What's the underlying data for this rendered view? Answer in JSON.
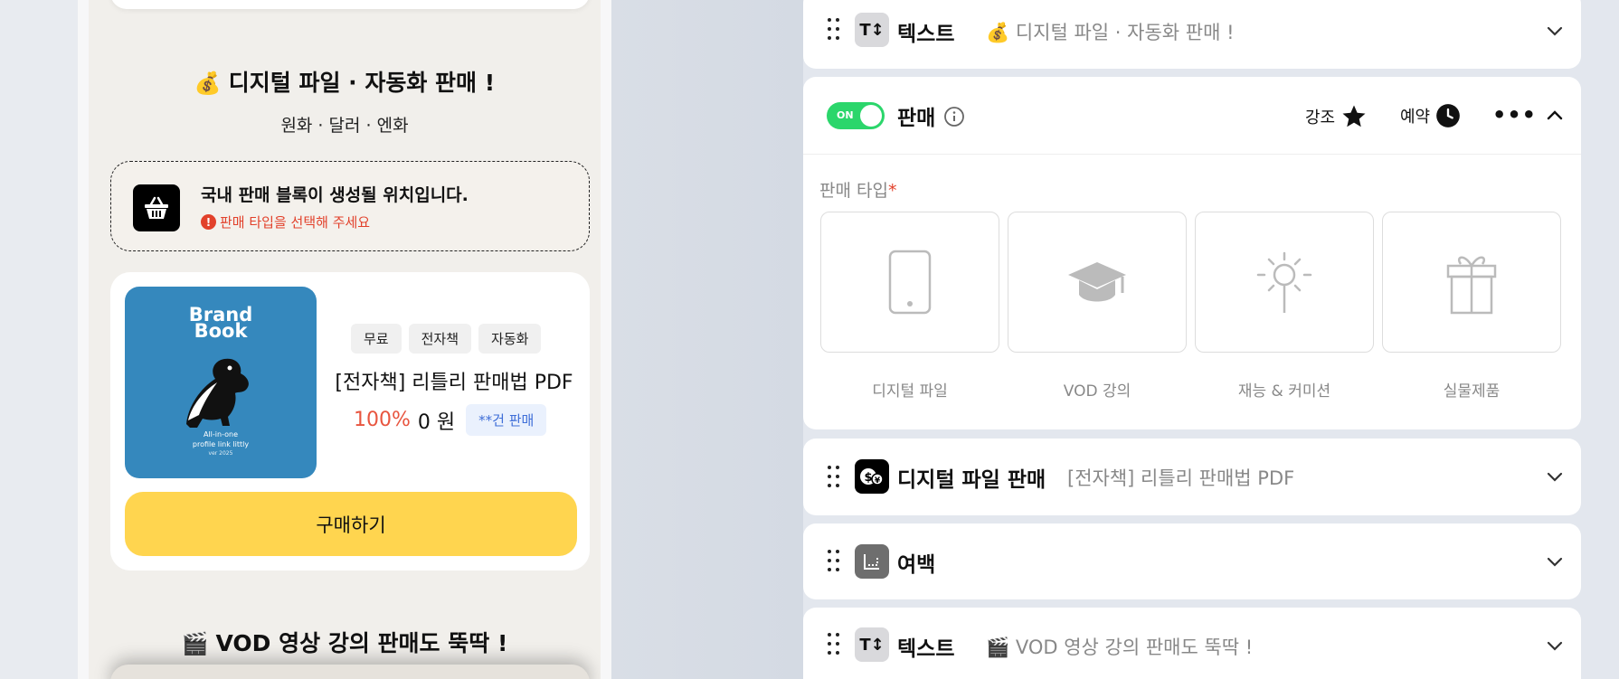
{
  "preview": {
    "heading1_emoji": "💰",
    "heading1": "디지털 파일 · 자동화 판매 !",
    "sub1": "원화 · 달러 · 엔화",
    "notice_title": "국내 판매 블록이 생성될 위치입니다.",
    "notice_warning": "판매 타입을 선택해 주세요",
    "cover_title_line1": "Brand",
    "cover_title_line2": "Book",
    "cover_small_line1": "All-in-one",
    "cover_small_line2": "profile link littly",
    "cover_version": "ver 2025",
    "tags": [
      "무료",
      "전자책",
      "자동화"
    ],
    "product_title": "[전자책] 리틀리 판매법 PDF",
    "discount": "100%",
    "price": "0 원",
    "sold_badge": "**건 판매",
    "buy_button": "구매하기",
    "heading2_emoji": "🎬",
    "heading2": "VOD 영상 강의 판매도 뚝딱 !"
  },
  "editor": {
    "text_block_1": {
      "title": "텍스트",
      "emoji": "💰",
      "summary": "디지털 파일 · 자동화 판매 !"
    },
    "sale_block": {
      "toggle_label": "ON",
      "title": "판매",
      "emphasis_label": "강조",
      "reserve_label": "예약",
      "more_label": "•••",
      "sale_type_label": "판매 타입",
      "required_mark": "*",
      "options": [
        {
          "label": "디지털 파일",
          "icon": "phone-icon"
        },
        {
          "label": "VOD 강의",
          "icon": "graduation-cap-icon"
        },
        {
          "label": "재능 & 커미션",
          "icon": "lightbulb-icon"
        },
        {
          "label": "실물제품",
          "icon": "gift-icon"
        }
      ]
    },
    "digital_block": {
      "title": "디지털 파일 판매",
      "summary": "[전자책] 리틀리 판매법 PDF"
    },
    "spacer_block": {
      "title": "여백"
    },
    "text_block_2": {
      "title": "텍스트",
      "emoji": "🎬",
      "summary": "VOD 영상 강의 판매도 뚝딱 !"
    }
  },
  "colors": {
    "accent_yellow": "#ffd54f",
    "toggle_green": "#2bd66b",
    "warning_red": "#e2412b",
    "cover_blue": "#3588bd"
  }
}
